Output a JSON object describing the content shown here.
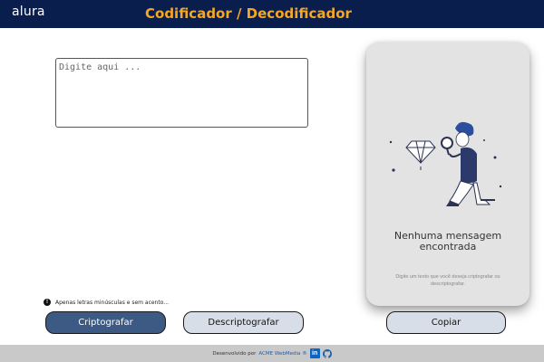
{
  "header": {
    "logo": "alura",
    "title": "Codificador / Decodificador",
    "bg_color": "#0a1e4e",
    "title_color": "#f5a623"
  },
  "input": {
    "placeholder": "Digite aqui ...",
    "value": ""
  },
  "warning": {
    "icon": "exclamation-icon",
    "text": "Apenas letras minúsculas e sem acento..."
  },
  "buttons": {
    "encrypt_label": "Criptografar",
    "decrypt_label": "Descriptografar",
    "copy_label": "Copiar"
  },
  "output_panel": {
    "empty_title": "Nenhuma mensagem encontrada",
    "empty_subtitle": "Digite um texto que você deseja criptografar ou descriptografar."
  },
  "footer": {
    "text_prefix": "Desenvolvido por",
    "company": "ACME WebMedia ®",
    "icons": [
      "linkedin-icon",
      "github-icon"
    ]
  }
}
